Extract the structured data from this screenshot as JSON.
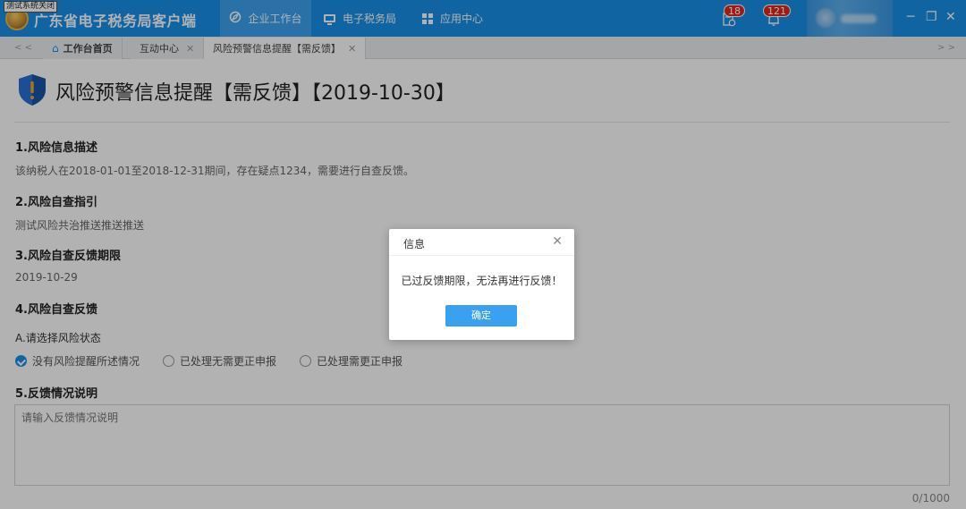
{
  "titlebar": {
    "test_badge": "测试系统关闭",
    "app_title": "广东省电子税务局客户端",
    "nav": [
      {
        "label": "企业工作台",
        "icon": "compass-icon",
        "active": true
      },
      {
        "label": "电子税务局",
        "icon": "monitor-icon",
        "active": false
      },
      {
        "label": "应用中心",
        "icon": "grid-icon",
        "active": false
      }
    ],
    "message_count": "18",
    "notification_count": "121",
    "window_controls": [
      "─",
      "❐",
      "✕"
    ]
  },
  "tabs": {
    "left_arrow": "< <",
    "right_arrow": "> >",
    "items": [
      {
        "label": "工作台首页",
        "closable": false,
        "active": false
      },
      {
        "label": "互动中心",
        "closable": true,
        "active": false
      },
      {
        "label": "风险预警信息提醒【需反馈】",
        "closable": true,
        "active": true
      }
    ]
  },
  "page": {
    "title": "风险预警信息提醒【需反馈】【2019-10-30】",
    "sections": [
      {
        "heading": "1.风险信息描述",
        "text": "该纳税人在2018-01-01至2018-12-31期间，存在疑点1234，需要进行自查反馈。"
      },
      {
        "heading": "2.风险自查指引",
        "text": "测试风险共治推送推送推送"
      },
      {
        "heading": "3.风险自查反馈期限",
        "text": "2019-10-29"
      },
      {
        "heading": "4.风险自查反馈",
        "text": "A.请选择风险状态"
      }
    ],
    "radio_options": [
      {
        "label": "没有风险提醒所述情况",
        "checked": true
      },
      {
        "label": "已处理无需更正申报",
        "checked": false
      },
      {
        "label": "已处理需更正申报",
        "checked": false
      }
    ],
    "feedback_heading": "5.反馈情况说明",
    "feedback_placeholder": "请输入反馈情况说明",
    "char_counter": "0/1000"
  },
  "modal": {
    "title": "信息",
    "message": "已过反馈期限，无法再进行反馈！",
    "confirm_label": "确定"
  },
  "colors": {
    "brand_blue": "#1890e8",
    "badge_red": "#e3261b",
    "confirm_blue": "#3aa0f0"
  }
}
